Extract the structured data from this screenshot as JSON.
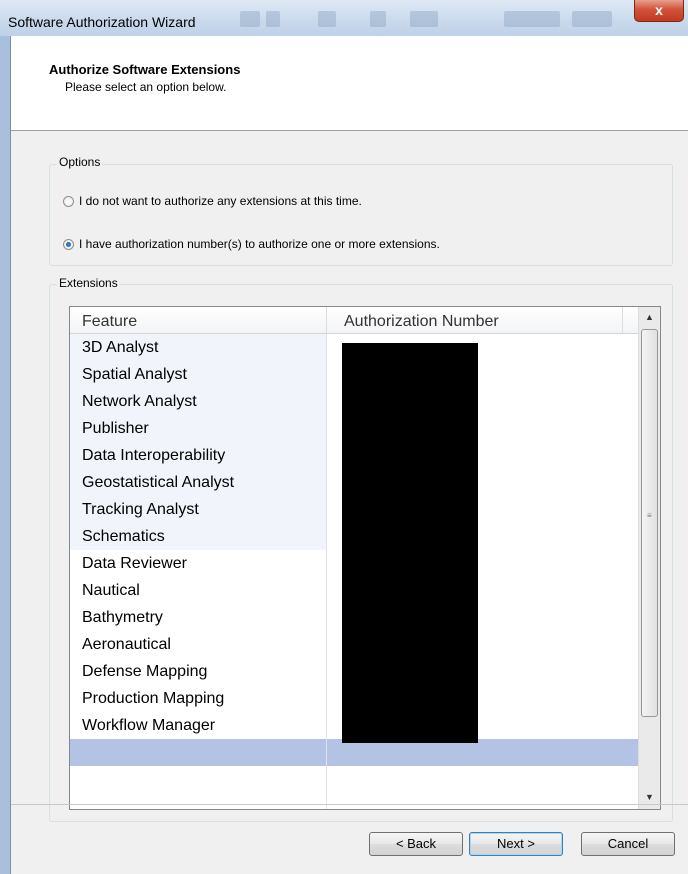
{
  "window": {
    "title": "Software Authorization Wizard",
    "close_label": "x"
  },
  "header": {
    "title": "Authorize Software Extensions",
    "subtitle": "Please select an option below."
  },
  "options": {
    "legend": "Options",
    "items": [
      {
        "label": "I do not want to authorize any extensions at this time.",
        "checked": false
      },
      {
        "label": "I have authorization number(s) to authorize one or more extensions.",
        "checked": true
      }
    ]
  },
  "extensions": {
    "legend": "Extensions",
    "columns": [
      "Feature",
      "Authorization Number"
    ],
    "rows": [
      "3D Analyst",
      "Spatial Analyst",
      "Network Analyst",
      "Publisher",
      "Data Interoperability",
      "Geostatistical Analyst",
      "Tracking Analyst",
      "Schematics",
      "Data Reviewer",
      "Nautical",
      "Bathymetry",
      "Aeronautical",
      "Defense Mapping",
      "Production Mapping",
      "Workflow Manager"
    ]
  },
  "buttons": {
    "back": "< Back",
    "next": "Next >",
    "cancel": "Cancel"
  },
  "colors": {
    "selection": "#b4c3e4",
    "redaction": "#000000"
  }
}
